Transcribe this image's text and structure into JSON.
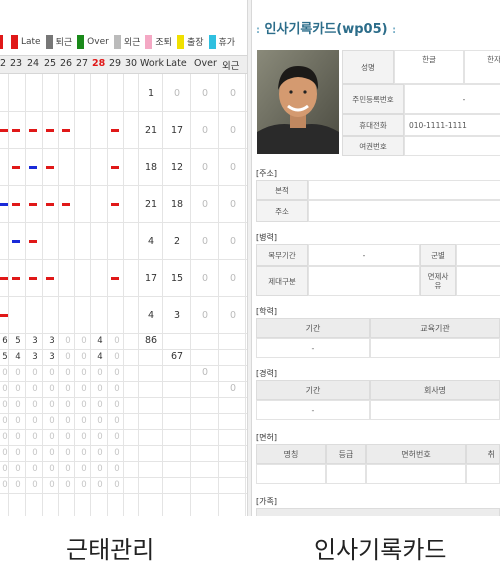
{
  "attendance": {
    "caption": "근태관리",
    "legend": [
      {
        "label": "",
        "color": "#e01818"
      },
      {
        "label": "Late",
        "color": "#e01818"
      },
      {
        "label": "퇴근",
        "color": "#777777"
      },
      {
        "label": "Over",
        "color": "#1a8a1a"
      },
      {
        "label": "외근",
        "color": "#bbbbbb"
      },
      {
        "label": "조퇴",
        "color": "#f4a8c4"
      },
      {
        "label": "출장",
        "color": "#f0e000"
      },
      {
        "label": "휴가",
        "color": "#30c0e0"
      }
    ],
    "day_headers": [
      {
        "text": "2",
        "red": false
      },
      {
        "text": "23",
        "red": false
      },
      {
        "text": "24",
        "red": false
      },
      {
        "text": "25",
        "red": false
      },
      {
        "text": "26",
        "red": false
      },
      {
        "text": "27",
        "red": false
      },
      {
        "text": "28",
        "red": true
      },
      {
        "text": "29",
        "red": false
      },
      {
        "text": "30",
        "red": false
      },
      {
        "text": "Work",
        "red": false
      },
      {
        "text": "Late",
        "red": false
      },
      {
        "text": "Over",
        "red": false
      },
      {
        "text": "외근",
        "red": false
      }
    ],
    "rows": [
      {
        "bars": [],
        "work": "1",
        "late": "0",
        "over": "0",
        "out": "0"
      },
      {
        "bars": [
          "r",
          "r",
          "r",
          "r",
          "r",
          "",
          "",
          "r",
          ""
        ],
        "work": "21",
        "late": "17",
        "over": "0",
        "out": "0"
      },
      {
        "bars": [
          "",
          "r",
          "b",
          "r",
          "",
          "",
          "",
          "r",
          ""
        ],
        "work": "18",
        "late": "12",
        "over": "0",
        "out": "0"
      },
      {
        "bars": [
          "b",
          "r",
          "r",
          "r",
          "r",
          "",
          "",
          "r",
          ""
        ],
        "work": "21",
        "late": "18",
        "over": "0",
        "out": "0"
      },
      {
        "bars": [
          "",
          "b",
          "r",
          "",
          "",
          "",
          "",
          "",
          ""
        ],
        "work": "4",
        "late": "2",
        "over": "0",
        "out": "0"
      },
      {
        "bars": [
          "r",
          "r",
          "r",
          "r",
          "",
          "",
          "",
          "r",
          ""
        ],
        "work": "17",
        "late": "15",
        "over": "0",
        "out": "0"
      },
      {
        "bars": [
          "r",
          "",
          "",
          "",
          "",
          "",
          "",
          "",
          ""
        ],
        "work": "4",
        "late": "3",
        "over": "0",
        "out": "0"
      }
    ],
    "summary_rows": [
      {
        "vals": [
          "6",
          "5",
          "3",
          "3",
          "0",
          "0",
          "4",
          "0"
        ],
        "work": "86",
        "late": "",
        "over": "",
        "out": ""
      },
      {
        "vals": [
          "5",
          "4",
          "3",
          "3",
          "0",
          "0",
          "4",
          "0"
        ],
        "work": "",
        "late": "67",
        "over": "",
        "out": ""
      },
      {
        "vals": [
          "0",
          "0",
          "0",
          "0",
          "0",
          "0",
          "0",
          "0"
        ],
        "work": "",
        "late": "",
        "over": "0",
        "out": ""
      },
      {
        "vals": [
          "0",
          "0",
          "0",
          "0",
          "0",
          "0",
          "0",
          "0"
        ],
        "work": "",
        "late": "",
        "over": "",
        "out": "0"
      },
      {
        "vals": [
          "0",
          "0",
          "0",
          "0",
          "0",
          "0",
          "0",
          "0"
        ],
        "work": "",
        "late": "",
        "over": "",
        "out": ""
      },
      {
        "vals": [
          "0",
          "0",
          "0",
          "0",
          "0",
          "0",
          "0",
          "0"
        ],
        "work": "",
        "late": "",
        "over": "",
        "out": ""
      },
      {
        "vals": [
          "0",
          "0",
          "0",
          "0",
          "0",
          "0",
          "0",
          "0"
        ],
        "work": "",
        "late": "",
        "over": "",
        "out": ""
      },
      {
        "vals": [
          "0",
          "0",
          "0",
          "0",
          "0",
          "0",
          "0",
          "0"
        ],
        "work": "",
        "late": "",
        "over": "",
        "out": ""
      },
      {
        "vals": [
          "0",
          "0",
          "0",
          "0",
          "0",
          "0",
          "0",
          "0"
        ],
        "work": "",
        "late": "",
        "over": "",
        "out": ""
      },
      {
        "vals": [
          "0",
          "0",
          "0",
          "0",
          "0",
          "0",
          "0",
          "0"
        ],
        "work": "",
        "late": "",
        "over": "",
        "out": ""
      }
    ]
  },
  "card": {
    "caption": "인사기록카드",
    "title": "인사기록카드(wp05)",
    "dots": ":",
    "name_label": "성명",
    "korean_label": "한글",
    "hanja_label": "한자",
    "resident_label": "주민등록번호",
    "resident_value": "-",
    "phone_label": "휴대전화",
    "phone_value": "010-1111-1111",
    "passport_label": "여권번호",
    "address_section": "[주소]",
    "domicile_label": "본적",
    "address_label": "주소",
    "military_section": "[병력]",
    "service_period_label": "복무기간",
    "service_period_value": "-",
    "branch_label": "군별",
    "discharge_label": "제대구분",
    "exemption_label": "면제사유",
    "education_section": "[학력]",
    "edu_period_label": "기간",
    "edu_school_label": "교육기관",
    "edu_period_value": "-",
    "career_section": "[경력]",
    "career_period_label": "기간",
    "career_company_label": "회사명",
    "career_period_value": "-",
    "license_section": "[면허]",
    "license_name_label": "명칭",
    "license_grade_label": "등급",
    "license_number_label": "면허번호",
    "license_acq_label": "취",
    "family_section": "[가족]"
  }
}
